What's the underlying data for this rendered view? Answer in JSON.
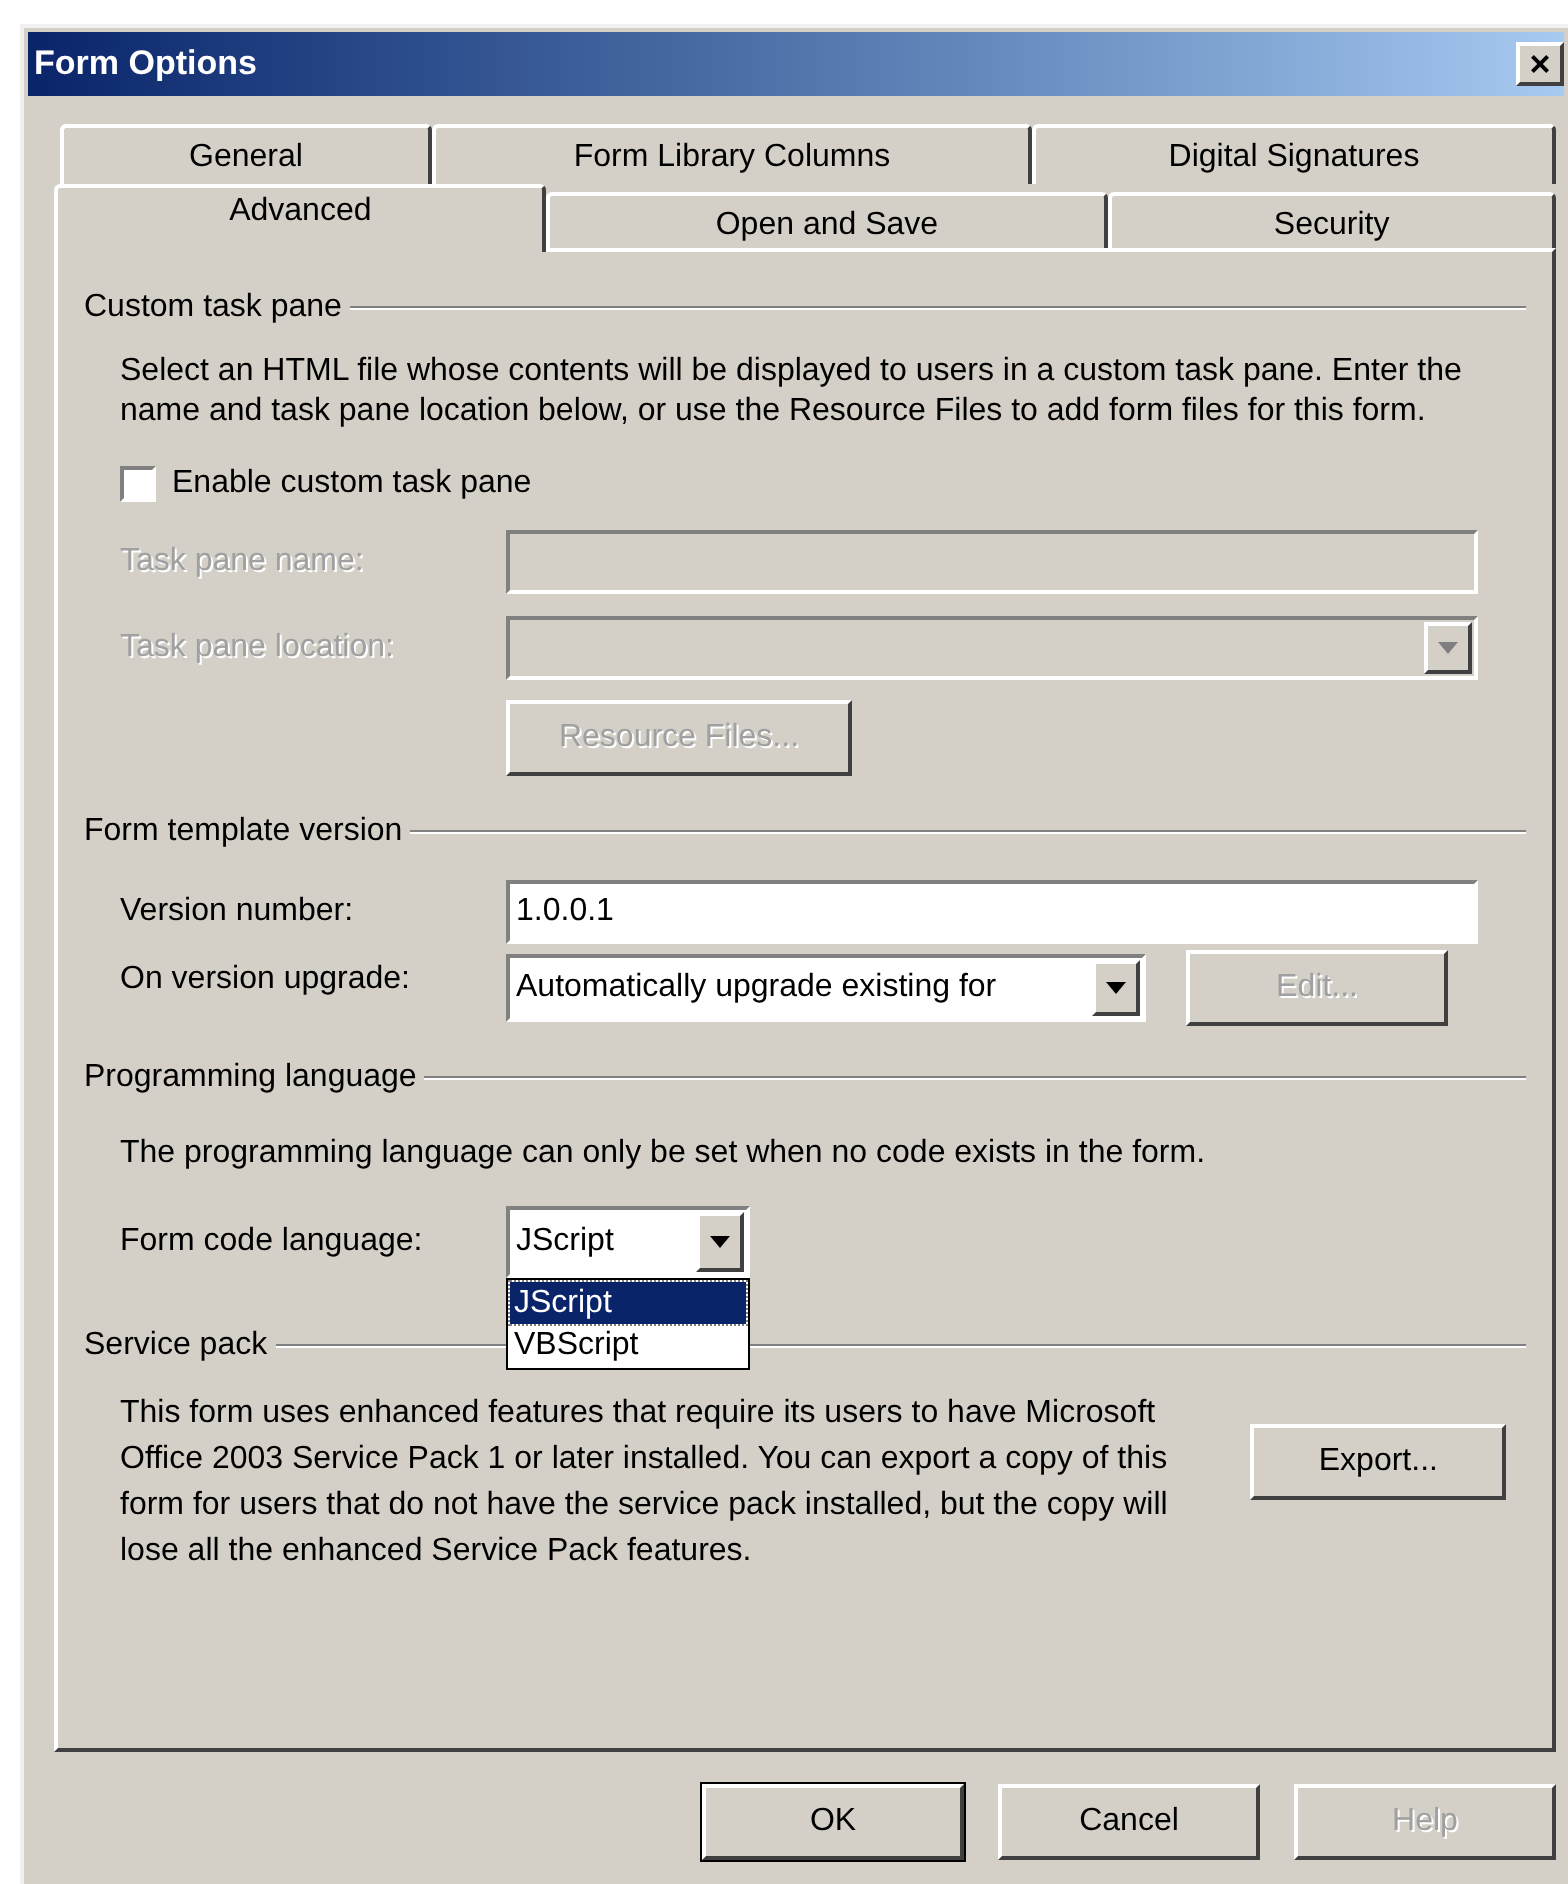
{
  "window": {
    "title": "Form Options",
    "close_glyph": "×"
  },
  "tab_rows": [
    [
      {
        "label": "General",
        "selected": false
      },
      {
        "label": "Form Library Columns",
        "selected": false
      },
      {
        "label": "Digital Signatures",
        "selected": false
      }
    ],
    [
      {
        "label": "Advanced",
        "selected": true
      },
      {
        "label": "Open and Save",
        "selected": false
      },
      {
        "label": "Security",
        "selected": false
      }
    ]
  ],
  "custom_task_pane": {
    "heading": "Custom task pane",
    "description": "Select an HTML file whose contents will be displayed to users in a custom task pane. Enter the name and task pane location below, or use the Resource Files to add form files for this form.",
    "enable_checkbox": {
      "label": "Enable custom task pane",
      "checked": false
    },
    "fields": [
      {
        "label": "Task pane name:",
        "kind": "text",
        "disabled": true
      },
      {
        "label": "Task pane location:",
        "kind": "combo",
        "disabled": true
      }
    ],
    "resource_button": {
      "label": "Resource Files...",
      "disabled": true
    }
  },
  "form_template_version": {
    "heading": "Form template version",
    "version_number": {
      "label": "Version number:",
      "value": "1.0.0.1"
    },
    "upgrade": {
      "label": "On version upgrade:",
      "value": "Automatically upgrade existing for"
    },
    "edit_button": {
      "label": "Edit...",
      "disabled": true
    }
  },
  "programming_language": {
    "heading": "Programming language",
    "description": "The programming language can only be set when no code exists in the form.",
    "code_language": {
      "label": "Form code language:",
      "value": "JScript",
      "expanded": true,
      "options": [
        {
          "label": "JScript",
          "selected": true
        },
        {
          "label": "VBScript",
          "selected": false
        }
      ]
    }
  },
  "service_pack": {
    "heading": "Service pack",
    "description": "This form uses enhanced features that require its users to have Microsoft Office 2003 Service Pack 1 or later installed. You can export a copy of this form for users that do not have the service pack installed, but the copy will lose all the enhanced Service Pack features.",
    "export_button": {
      "label": "Export...",
      "disabled": false
    }
  },
  "buttons": [
    {
      "label": "OK",
      "default": true,
      "disabled": false
    },
    {
      "label": "Cancel",
      "default": false,
      "disabled": false
    },
    {
      "label": "Help",
      "default": false,
      "disabled": true
    }
  ]
}
